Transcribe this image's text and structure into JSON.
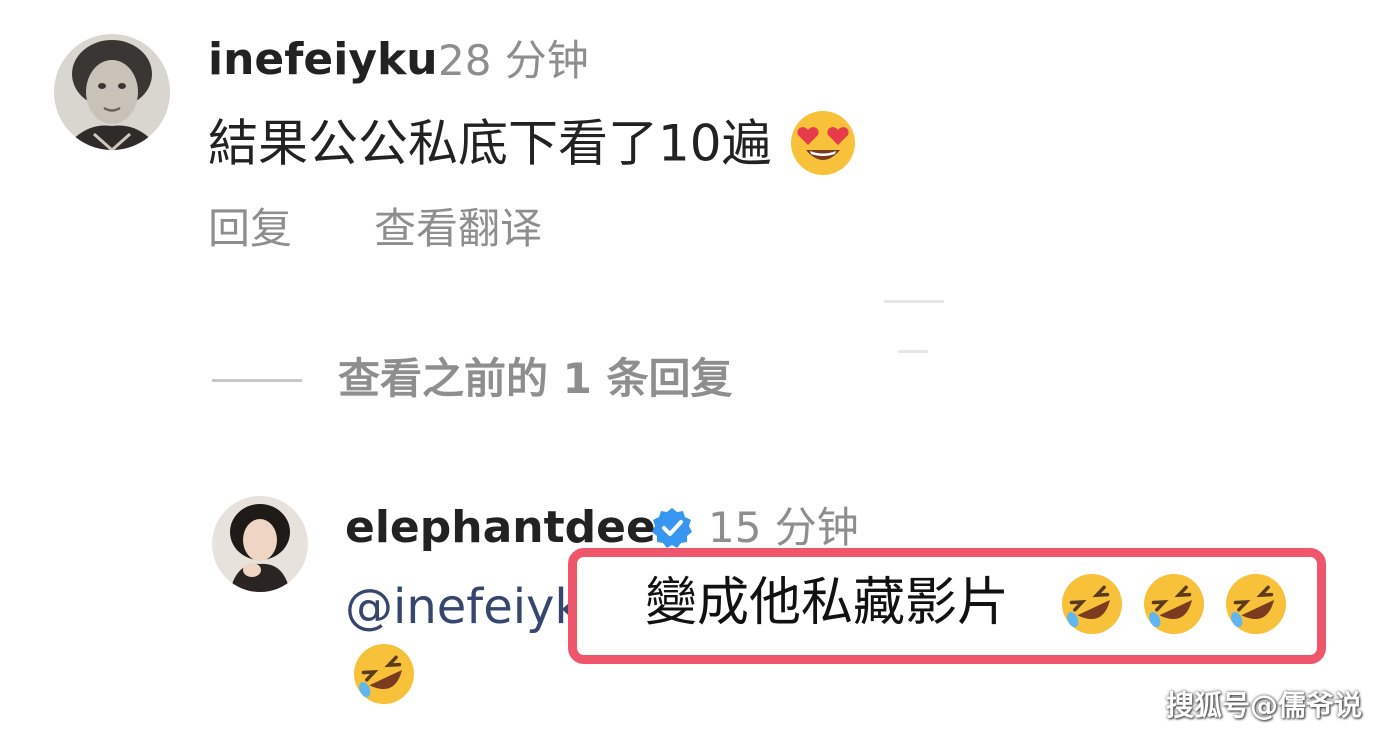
{
  "comment1": {
    "username": "inefeiyku",
    "time": "28 分钟",
    "text": "結果公公私底下看了10遍",
    "emoji_icon": "heart-eyes-emoji",
    "reply_label": "回复",
    "translate_label": "查看翻译"
  },
  "thread": {
    "view_previous_label": "查看之前的 1 条回复"
  },
  "comment2": {
    "username": "elephantdee",
    "verified_icon": "verified-badge-icon",
    "time": "15 分钟",
    "mention": "@inefeiyku",
    "text": "變成他私藏影片",
    "emoji_icon": "rofl-emoji"
  },
  "watermark": "搜狐号@儒爷说",
  "colors": {
    "highlight_border": "#f0566b",
    "verified_blue": "#3797f0",
    "muted_text": "#8e8e8e",
    "mention_text": "#36466e"
  }
}
